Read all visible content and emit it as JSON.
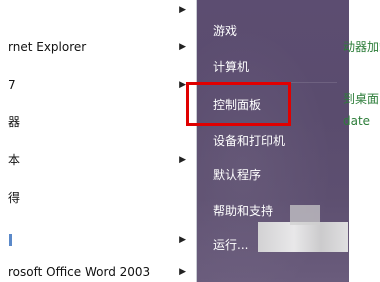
{
  "left_menu": {
    "items": [
      {
        "label": "",
        "arrow": "▶",
        "blue": false
      },
      {
        "label": "rnet Explorer",
        "arrow": "▶",
        "blue": false
      },
      {
        "label": "7",
        "arrow": "▶",
        "blue": false
      },
      {
        "label": "器",
        "arrow": "",
        "blue": false
      },
      {
        "label": "本",
        "arrow": "▶",
        "blue": false
      },
      {
        "label": "得",
        "arrow": "",
        "blue": false
      },
      {
        "label": "",
        "arrow": "▶",
        "blue": true
      },
      {
        "label": "rosoft Office Word 2003",
        "arrow": "▶",
        "blue": false
      }
    ]
  },
  "right_menu": {
    "items": [
      {
        "label": "游戏"
      },
      {
        "label": "计算机"
      },
      {
        "label": "控制面板"
      },
      {
        "label": "设备和打印机"
      },
      {
        "label": "默认程序"
      },
      {
        "label": "帮助和支持"
      },
      {
        "label": "运行..."
      }
    ]
  },
  "background_right": {
    "texts": [
      "动器加载",
      "到桌面",
      "date"
    ]
  },
  "highlight_color": "#e00000"
}
